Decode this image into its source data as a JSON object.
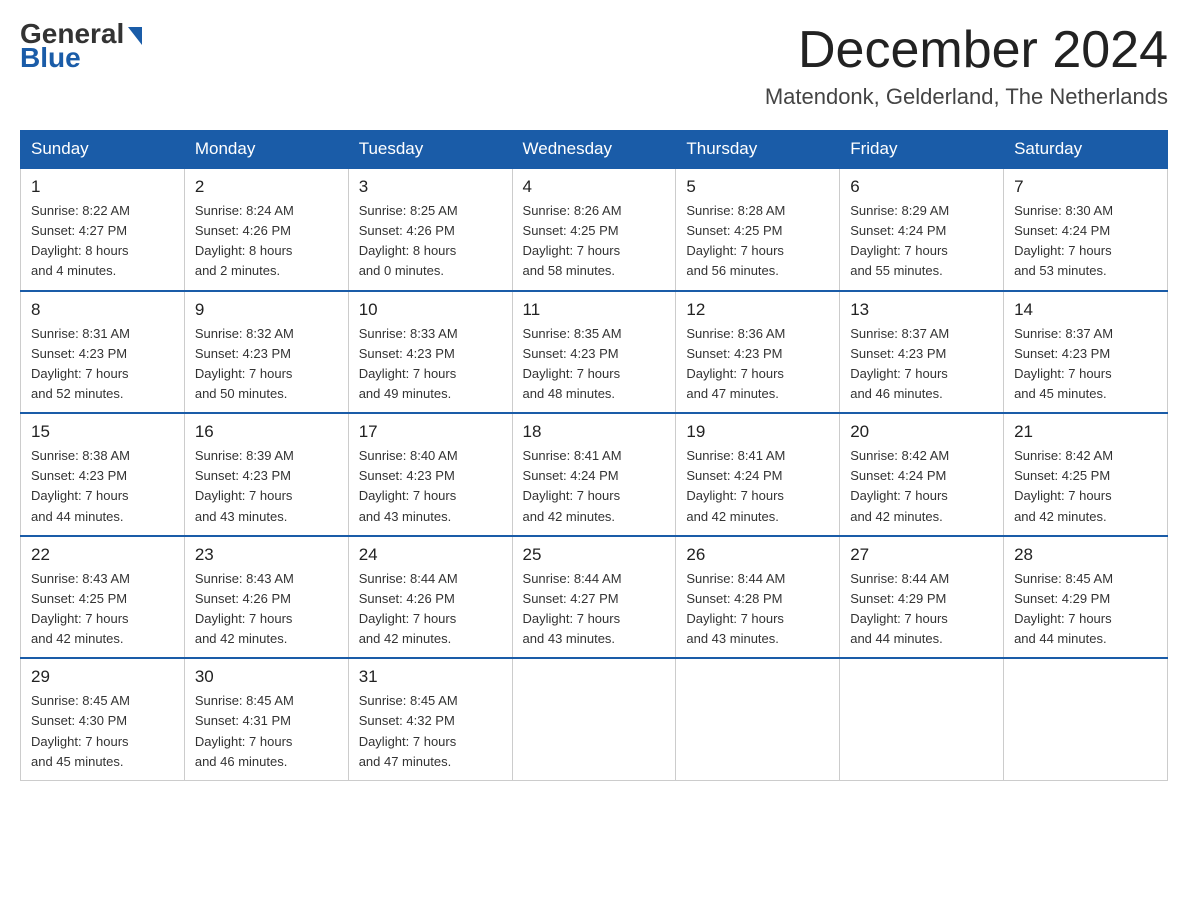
{
  "header": {
    "logo_general": "General",
    "logo_blue": "Blue",
    "month_year": "December 2024",
    "location": "Matendonk, Gelderland, The Netherlands"
  },
  "days_of_week": [
    "Sunday",
    "Monday",
    "Tuesday",
    "Wednesday",
    "Thursday",
    "Friday",
    "Saturday"
  ],
  "weeks": [
    [
      {
        "day": "1",
        "sunrise": "8:22 AM",
        "sunset": "4:27 PM",
        "daylight": "8 hours and 4 minutes."
      },
      {
        "day": "2",
        "sunrise": "8:24 AM",
        "sunset": "4:26 PM",
        "daylight": "8 hours and 2 minutes."
      },
      {
        "day": "3",
        "sunrise": "8:25 AM",
        "sunset": "4:26 PM",
        "daylight": "8 hours and 0 minutes."
      },
      {
        "day": "4",
        "sunrise": "8:26 AM",
        "sunset": "4:25 PM",
        "daylight": "7 hours and 58 minutes."
      },
      {
        "day": "5",
        "sunrise": "8:28 AM",
        "sunset": "4:25 PM",
        "daylight": "7 hours and 56 minutes."
      },
      {
        "day": "6",
        "sunrise": "8:29 AM",
        "sunset": "4:24 PM",
        "daylight": "7 hours and 55 minutes."
      },
      {
        "day": "7",
        "sunrise": "8:30 AM",
        "sunset": "4:24 PM",
        "daylight": "7 hours and 53 minutes."
      }
    ],
    [
      {
        "day": "8",
        "sunrise": "8:31 AM",
        "sunset": "4:23 PM",
        "daylight": "7 hours and 52 minutes."
      },
      {
        "day": "9",
        "sunrise": "8:32 AM",
        "sunset": "4:23 PM",
        "daylight": "7 hours and 50 minutes."
      },
      {
        "day": "10",
        "sunrise": "8:33 AM",
        "sunset": "4:23 PM",
        "daylight": "7 hours and 49 minutes."
      },
      {
        "day": "11",
        "sunrise": "8:35 AM",
        "sunset": "4:23 PM",
        "daylight": "7 hours and 48 minutes."
      },
      {
        "day": "12",
        "sunrise": "8:36 AM",
        "sunset": "4:23 PM",
        "daylight": "7 hours and 47 minutes."
      },
      {
        "day": "13",
        "sunrise": "8:37 AM",
        "sunset": "4:23 PM",
        "daylight": "7 hours and 46 minutes."
      },
      {
        "day": "14",
        "sunrise": "8:37 AM",
        "sunset": "4:23 PM",
        "daylight": "7 hours and 45 minutes."
      }
    ],
    [
      {
        "day": "15",
        "sunrise": "8:38 AM",
        "sunset": "4:23 PM",
        "daylight": "7 hours and 44 minutes."
      },
      {
        "day": "16",
        "sunrise": "8:39 AM",
        "sunset": "4:23 PM",
        "daylight": "7 hours and 43 minutes."
      },
      {
        "day": "17",
        "sunrise": "8:40 AM",
        "sunset": "4:23 PM",
        "daylight": "7 hours and 43 minutes."
      },
      {
        "day": "18",
        "sunrise": "8:41 AM",
        "sunset": "4:24 PM",
        "daylight": "7 hours and 42 minutes."
      },
      {
        "day": "19",
        "sunrise": "8:41 AM",
        "sunset": "4:24 PM",
        "daylight": "7 hours and 42 minutes."
      },
      {
        "day": "20",
        "sunrise": "8:42 AM",
        "sunset": "4:24 PM",
        "daylight": "7 hours and 42 minutes."
      },
      {
        "day": "21",
        "sunrise": "8:42 AM",
        "sunset": "4:25 PM",
        "daylight": "7 hours and 42 minutes."
      }
    ],
    [
      {
        "day": "22",
        "sunrise": "8:43 AM",
        "sunset": "4:25 PM",
        "daylight": "7 hours and 42 minutes."
      },
      {
        "day": "23",
        "sunrise": "8:43 AM",
        "sunset": "4:26 PM",
        "daylight": "7 hours and 42 minutes."
      },
      {
        "day": "24",
        "sunrise": "8:44 AM",
        "sunset": "4:26 PM",
        "daylight": "7 hours and 42 minutes."
      },
      {
        "day": "25",
        "sunrise": "8:44 AM",
        "sunset": "4:27 PM",
        "daylight": "7 hours and 43 minutes."
      },
      {
        "day": "26",
        "sunrise": "8:44 AM",
        "sunset": "4:28 PM",
        "daylight": "7 hours and 43 minutes."
      },
      {
        "day": "27",
        "sunrise": "8:44 AM",
        "sunset": "4:29 PM",
        "daylight": "7 hours and 44 minutes."
      },
      {
        "day": "28",
        "sunrise": "8:45 AM",
        "sunset": "4:29 PM",
        "daylight": "7 hours and 44 minutes."
      }
    ],
    [
      {
        "day": "29",
        "sunrise": "8:45 AM",
        "sunset": "4:30 PM",
        "daylight": "7 hours and 45 minutes."
      },
      {
        "day": "30",
        "sunrise": "8:45 AM",
        "sunset": "4:31 PM",
        "daylight": "7 hours and 46 minutes."
      },
      {
        "day": "31",
        "sunrise": "8:45 AM",
        "sunset": "4:32 PM",
        "daylight": "7 hours and 47 minutes."
      },
      null,
      null,
      null,
      null
    ]
  ],
  "labels": {
    "sunrise": "Sunrise:",
    "sunset": "Sunset:",
    "daylight": "Daylight:"
  }
}
